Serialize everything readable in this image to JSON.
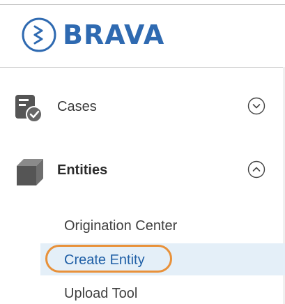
{
  "brand": {
    "name": "BRAVA",
    "color": "#2f6ab1"
  },
  "nav": [
    {
      "label": "Cases",
      "icon": "cases-icon",
      "chevron": "chevron-down-circle-icon",
      "expanded": false
    },
    {
      "label": "Entities",
      "icon": "entities-cube-icon",
      "chevron": "chevron-up-circle-icon",
      "expanded": true,
      "children": [
        {
          "label": "Origination Center"
        },
        {
          "label": "Create Entity",
          "selected": true,
          "highlight_color": "#e8913a"
        },
        {
          "label": "Upload Tool"
        }
      ]
    }
  ]
}
